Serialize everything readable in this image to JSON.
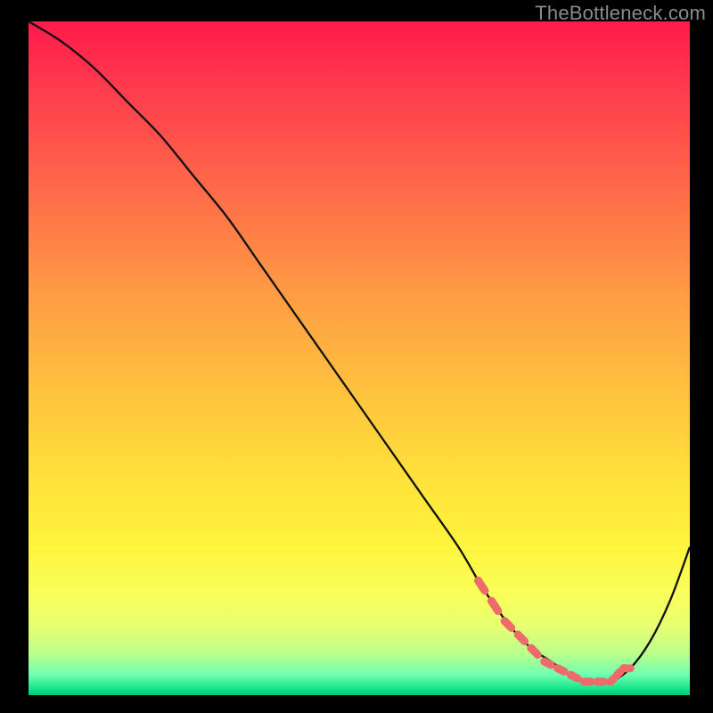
{
  "attribution": "TheBottleneck.com",
  "colors": {
    "background": "#000000",
    "gradient_top": "#ff1a4b",
    "gradient_bottom": "#00c878",
    "curve": "#111111",
    "markers": "#ef6a6a"
  },
  "chart_data": {
    "type": "line",
    "title": "",
    "xlabel": "",
    "ylabel": "",
    "xlim": [
      0,
      100
    ],
    "ylim": [
      0,
      100
    ],
    "series": [
      {
        "name": "bottleneck-curve",
        "x": [
          0,
          5,
          10,
          15,
          20,
          25,
          30,
          35,
          40,
          45,
          50,
          55,
          60,
          65,
          68,
          70,
          73,
          76,
          79,
          82,
          85,
          88,
          91,
          94,
          97,
          100
        ],
        "y": [
          100,
          97,
          93,
          88,
          83,
          77,
          71,
          64,
          57,
          50,
          43,
          36,
          29,
          22,
          17,
          14,
          10,
          7,
          5,
          3,
          2,
          2,
          4,
          8,
          14,
          22
        ]
      }
    ],
    "markers": {
      "name": "sweet-spot",
      "x": [
        68,
        70,
        72,
        74,
        76,
        78,
        80,
        82,
        84,
        86,
        88,
        89,
        90,
        91
      ],
      "y": [
        17,
        14,
        11,
        9,
        7,
        5,
        4,
        3,
        2,
        2,
        2,
        3,
        4,
        4
      ]
    }
  }
}
